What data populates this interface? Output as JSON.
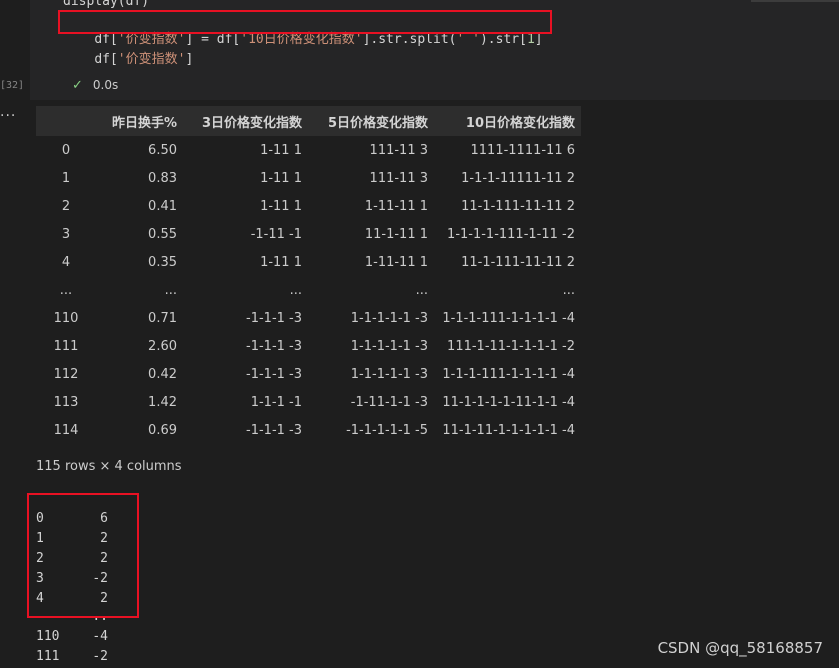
{
  "code": {
    "line0": "display(df)",
    "line1_parts": [
      "df[",
      "'价变指数'",
      "] = df[",
      "'10日价格变化指数'",
      "].str.split(",
      "' '",
      ").str[",
      "1",
      "]"
    ],
    "line2_parts": [
      "df[",
      "'价变指数'",
      "]"
    ]
  },
  "cell": {
    "exec_count": "[32]",
    "more_label": "...",
    "status_time": "0.0s",
    "check_icon": "check-icon"
  },
  "dataframe": {
    "columns": [
      "",
      "昨日换手%",
      "3日价格变化指数",
      "5日价格变化指数",
      "10日价格变化指数"
    ],
    "rows": [
      [
        "0",
        "6.50",
        "1-11 1",
        "111-11 3",
        "1111-1111-11 6"
      ],
      [
        "1",
        "0.83",
        "1-11 1",
        "111-11 3",
        "1-1-1-11111-11 2"
      ],
      [
        "2",
        "0.41",
        "1-11 1",
        "1-11-11 1",
        "11-1-111-11-11 2"
      ],
      [
        "3",
        "0.55",
        "-1-11 -1",
        "11-1-11 1",
        "1-1-1-1-111-1-11 -2"
      ],
      [
        "4",
        "0.35",
        "1-11 1",
        "1-11-11 1",
        "11-1-111-11-11 2"
      ],
      [
        "...",
        "...",
        "...",
        "...",
        "..."
      ],
      [
        "110",
        "0.71",
        "-1-1-1 -3",
        "1-1-1-1-1 -3",
        "1-1-1-111-1-1-1-1 -4"
      ],
      [
        "111",
        "2.60",
        "-1-1-1 -3",
        "1-1-1-1-1 -3",
        "111-1-11-1-1-1-1 -2"
      ],
      [
        "112",
        "0.42",
        "-1-1-1 -3",
        "1-1-1-1-1 -3",
        "1-1-1-111-1-1-1-1 -4"
      ],
      [
        "113",
        "1.42",
        "1-1-1 -1",
        "-1-11-1-1 -3",
        "11-1-1-1-1-11-1-1 -4"
      ],
      [
        "114",
        "0.69",
        "-1-1-1 -3",
        "-1-1-1-1-1 -5",
        "11-1-11-1-1-1-1-1 -4"
      ]
    ],
    "shape_text": "115 rows × 4 columns"
  },
  "series_output": {
    "rows": [
      [
        "0",
        "6"
      ],
      [
        "1",
        "2"
      ],
      [
        "2",
        "2"
      ],
      [
        "3",
        "-2"
      ],
      [
        "4",
        "2"
      ],
      [
        "",
        ".."
      ],
      [
        "110",
        "-4"
      ],
      [
        "111",
        "-2"
      ]
    ]
  },
  "watermark": "CSDN @qq_58168857",
  "colors": {
    "highlight": "#e81123",
    "background": "#1e1e1e",
    "string": "#ce9178",
    "number": "#b5cea8"
  }
}
